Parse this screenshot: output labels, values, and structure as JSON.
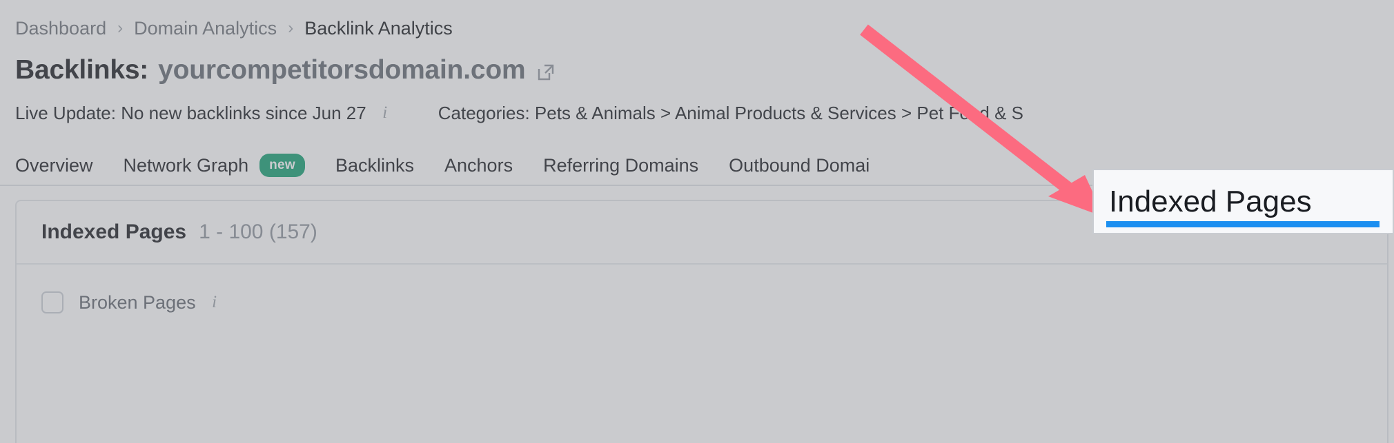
{
  "breadcrumb": {
    "items": [
      {
        "label": "Dashboard",
        "current": false
      },
      {
        "label": "Domain Analytics",
        "current": false
      },
      {
        "label": "Backlink Analytics",
        "current": true
      }
    ],
    "separator": "›"
  },
  "header": {
    "title_prefix": "Backlinks:",
    "domain": "yourcompetitorsdomain.com",
    "external_link_icon": "external-link-icon"
  },
  "meta": {
    "live_update": "Live Update: No new backlinks since Jun 27",
    "live_update_info_icon": "i",
    "categories": "Categories: Pets & Animals > Animal Products & Services > Pet Food & S"
  },
  "tabs": [
    {
      "label": "Overview",
      "badge": null
    },
    {
      "label": "Network Graph",
      "badge": "new"
    },
    {
      "label": "Backlinks",
      "badge": null
    },
    {
      "label": "Anchors",
      "badge": null
    },
    {
      "label": "Referring Domains",
      "badge": null
    },
    {
      "label": "Outbound Domai",
      "badge": null
    }
  ],
  "panel": {
    "title": "Indexed Pages",
    "count": "1 - 100 (157)",
    "filter": {
      "checkbox_label": "Broken Pages",
      "info_icon": "i"
    }
  },
  "annotation": {
    "callout_text": "Indexed Pages",
    "arrow_color": "#FC6B80",
    "underline_color": "#1B8FF0",
    "badge_color": "#0F9D6E"
  }
}
